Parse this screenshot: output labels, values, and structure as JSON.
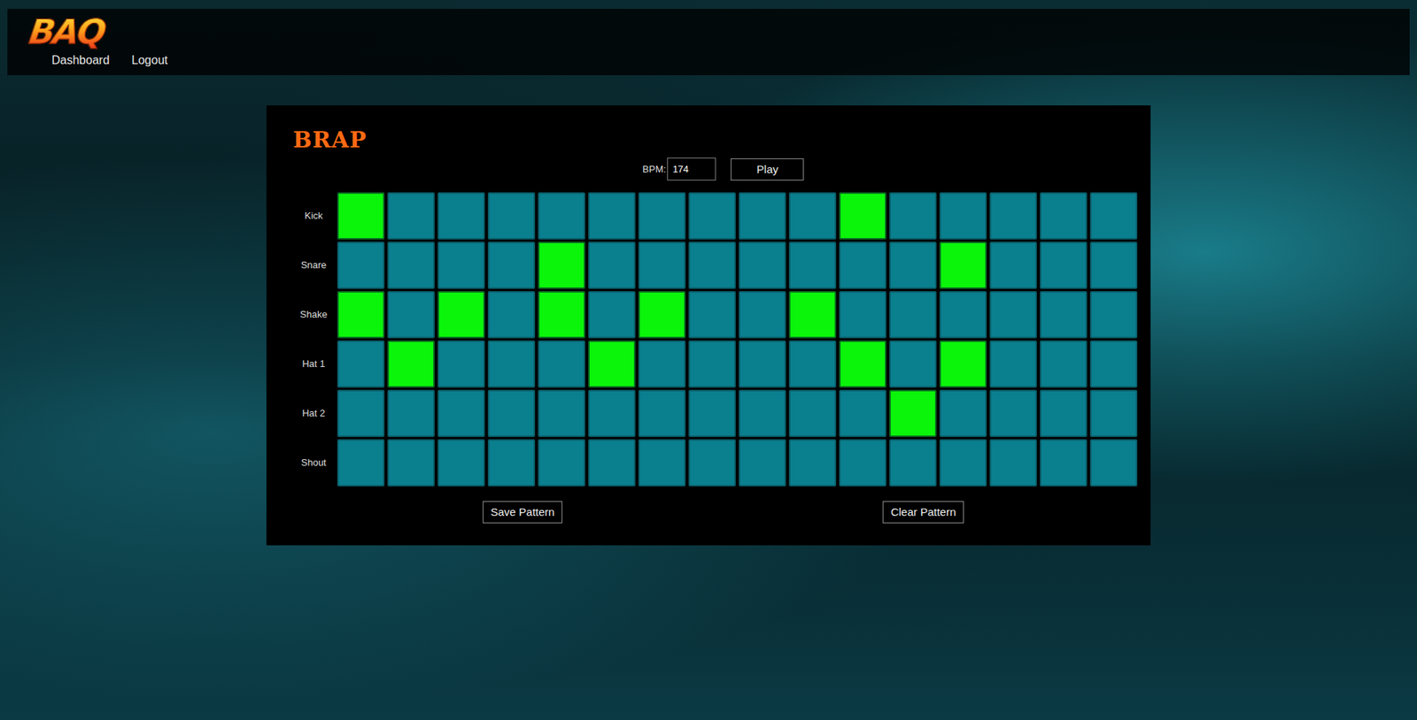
{
  "brand": "BAQ",
  "nav_links": [
    "Dashboard",
    "Logout"
  ],
  "title": "BRAP",
  "bpm": {
    "label": "BPM:",
    "value": "174"
  },
  "play_button": "Play",
  "tracks": [
    {
      "name": "Kick",
      "steps": [
        true,
        false,
        false,
        false,
        false,
        false,
        false,
        false,
        false,
        false,
        true,
        false,
        false,
        false,
        false,
        false
      ]
    },
    {
      "name": "Snare",
      "steps": [
        false,
        false,
        false,
        false,
        true,
        false,
        false,
        false,
        false,
        false,
        false,
        false,
        true,
        false,
        false,
        false
      ]
    },
    {
      "name": "Shake",
      "steps": [
        true,
        false,
        true,
        false,
        true,
        false,
        true,
        false,
        false,
        true,
        false,
        false,
        false,
        false,
        false,
        false
      ]
    },
    {
      "name": "Hat 1",
      "steps": [
        false,
        true,
        false,
        false,
        false,
        true,
        false,
        false,
        false,
        false,
        true,
        false,
        true,
        false,
        false,
        false
      ]
    },
    {
      "name": "Hat 2",
      "steps": [
        false,
        false,
        false,
        false,
        false,
        false,
        false,
        false,
        false,
        false,
        false,
        true,
        false,
        false,
        false,
        false
      ]
    },
    {
      "name": "Shout",
      "steps": [
        false,
        false,
        false,
        false,
        false,
        false,
        false,
        false,
        false,
        false,
        false,
        false,
        false,
        false,
        false,
        false
      ]
    }
  ],
  "buttons": [
    "Save Pattern",
    "Clear Pattern"
  ]
}
